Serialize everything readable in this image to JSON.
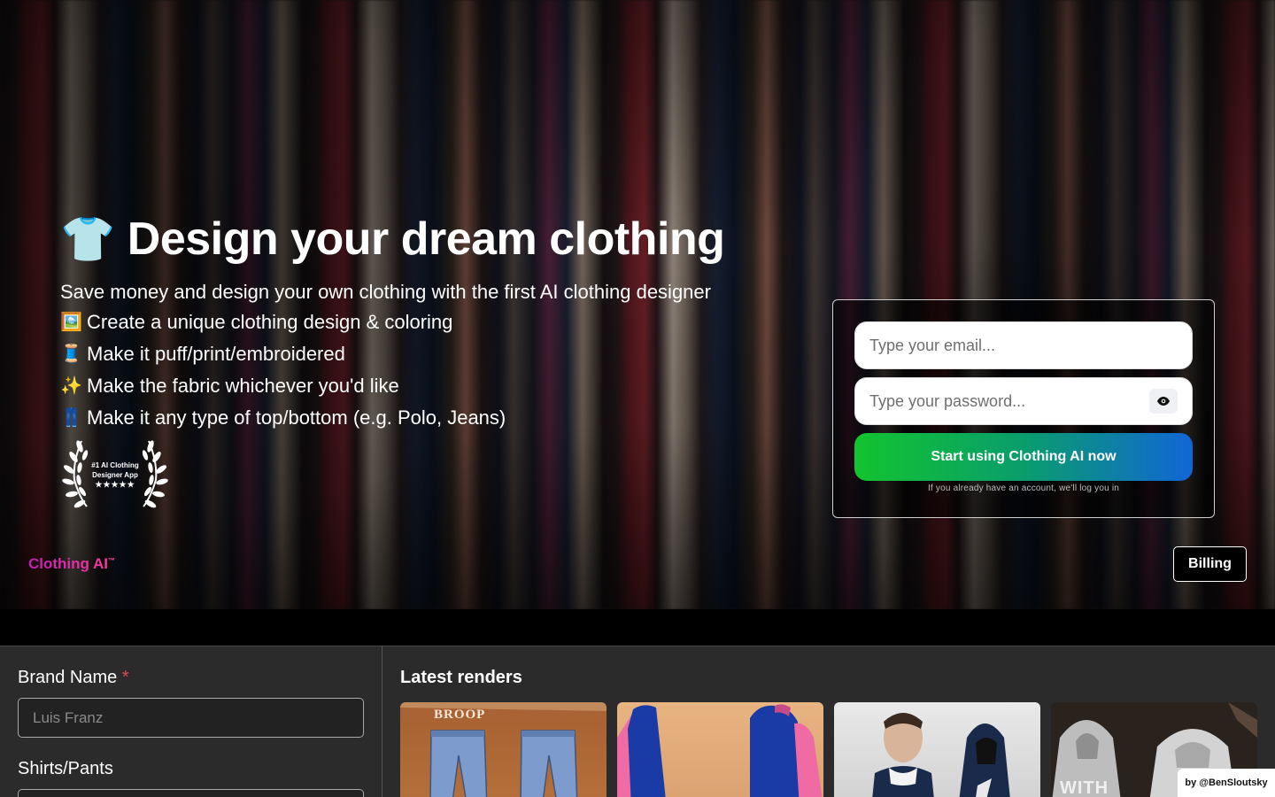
{
  "hero": {
    "title_emoji": "👕",
    "title": "Design your dream clothing",
    "subtitle": "Save money and design your own clothing with the first AI clothing designer",
    "features": [
      {
        "emoji": "🖼️",
        "text": "Create a unique clothing design & coloring"
      },
      {
        "emoji": "🧵",
        "text": "Make it puff/print/embroidered"
      },
      {
        "emoji": "✨",
        "text": "Make the fabric whichever you'd like"
      },
      {
        "emoji": "👖",
        "text": "Make it any type of top/bottom (e.g. Polo, Jeans)"
      }
    ],
    "badge": {
      "line1": "#1 AI Clothing",
      "line2": "Designer App",
      "stars": "★★★★★"
    }
  },
  "login": {
    "email_placeholder": "Type your email...",
    "password_placeholder": "Type your password...",
    "submit_label": "Start using Clothing AI now",
    "hint": "If you already have an account, we'll log you in"
  },
  "brand": {
    "name": "Clothing AI",
    "tm": "™"
  },
  "header": {
    "billing_label": "Billing"
  },
  "form": {
    "brand_name_label": "Brand Name",
    "required_mark": "*",
    "brand_name_placeholder": "Luis Franz",
    "shirts_pants_label": "Shirts/Pants"
  },
  "renders": {
    "title": "Latest renders",
    "items": [
      {
        "text": "BROOP"
      },
      {
        "text": ""
      },
      {
        "text": ""
      },
      {
        "text": "WITH"
      }
    ]
  },
  "credit": "by @BenSloutsky",
  "colors": {
    "accent_gradient_start": "#12c42f",
    "accent_gradient_end": "#1166d6",
    "brand_pink": "#c01fb5",
    "required_red": "#e5484d"
  }
}
